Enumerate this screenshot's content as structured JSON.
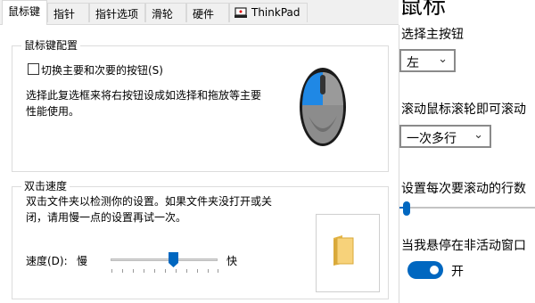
{
  "background_settings": {
    "heading": "鼠标",
    "primary_button_label": "选择主按钮",
    "primary_button_value": "左",
    "scroll_label": "滚动鼠标滚轮即可滚动",
    "scroll_value": "一次多行",
    "lines_label": "设置每次要滚动的行数",
    "inactive_scroll_label": "当我悬停在非活动窗口",
    "toggle_state": "开",
    "accent_color": "#0067c0"
  },
  "dialog": {
    "tabs": [
      {
        "label": "鼠标键"
      },
      {
        "label": "指针"
      },
      {
        "label": "指针选项"
      },
      {
        "label": "滑轮"
      },
      {
        "label": "硬件"
      },
      {
        "label": "ThinkPad"
      }
    ],
    "active_tab": "鼠标键",
    "button_config": {
      "title": "鼠标键配置",
      "switch_checkbox_label": "切换主要和次要的按钮(S)",
      "switch_checked": false,
      "description_line1": "选择此复选框来将右按钮设成如选择和拖放等主要",
      "description_line2": "性能使用。"
    },
    "double_click": {
      "title": "双击速度",
      "description_line1": "双击文件夹以检测你的设置。如果文件夹没打开或关",
      "description_line2": "闭，请用慢一点的设置再试一次。",
      "speed_label": "速度(D):",
      "slow_label": "慢",
      "fast_label": "快",
      "speed_fraction": 0.6
    }
  }
}
